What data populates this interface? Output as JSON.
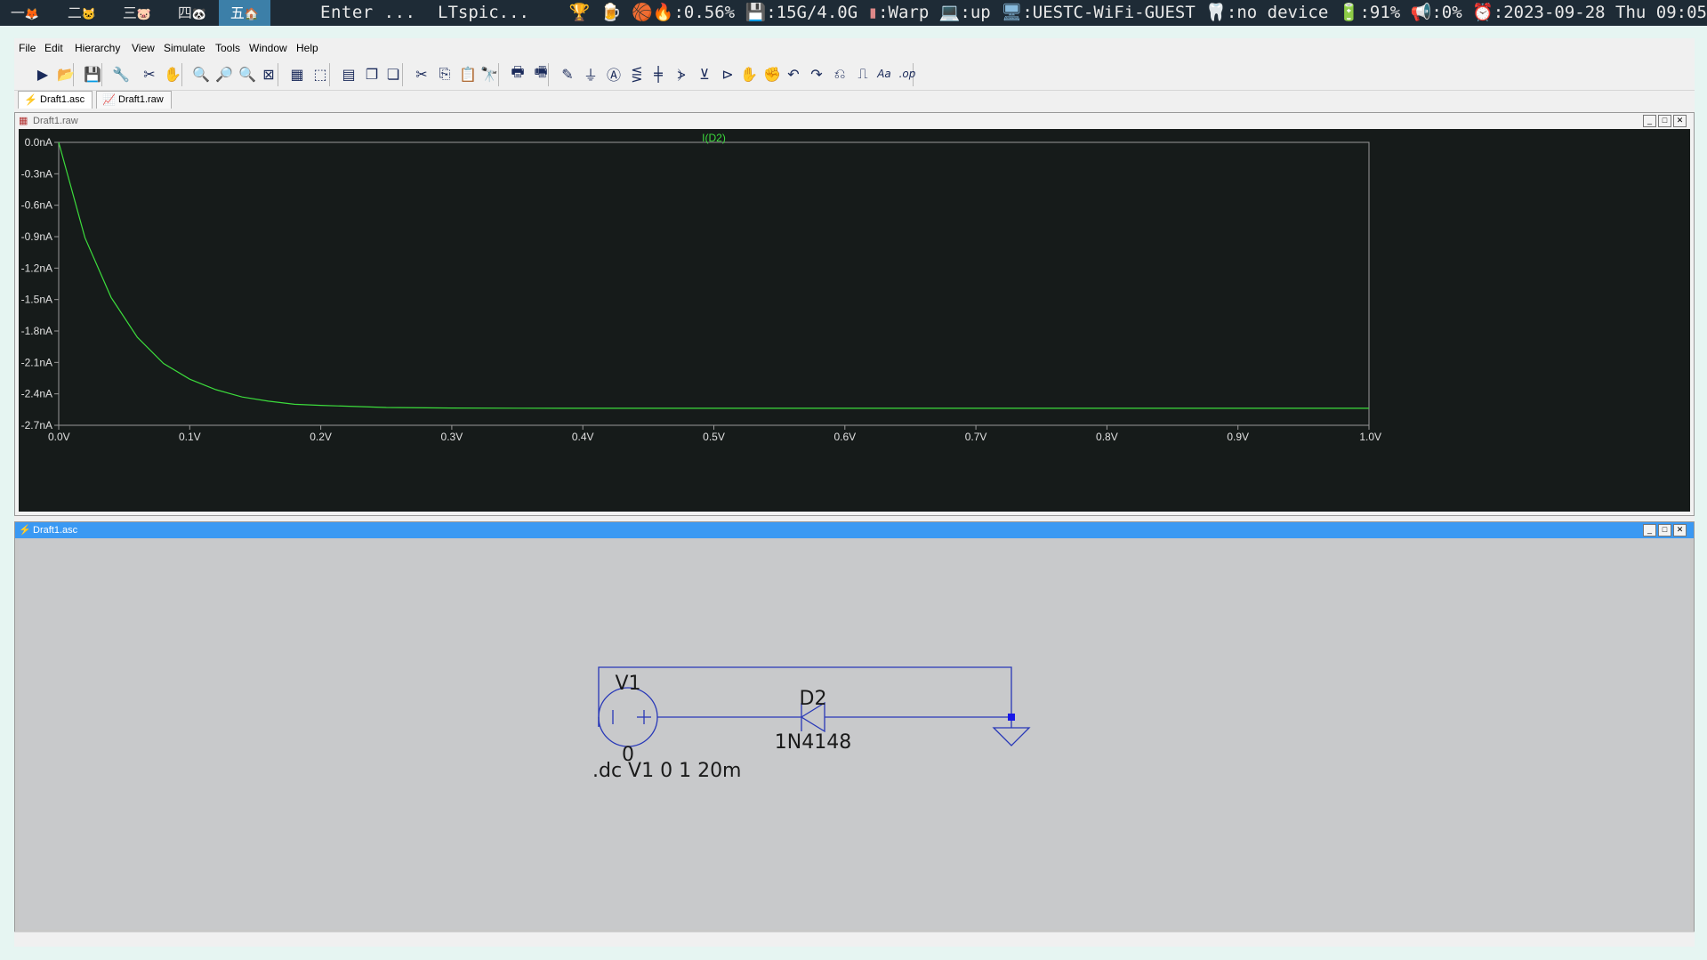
{
  "topbar": {
    "workspaces": [
      {
        "label": "一",
        "icon": "fox-icon",
        "glyph": "🦊"
      },
      {
        "label": "二",
        "icon": "cat-icon",
        "glyph": "🐱"
      },
      {
        "label": "三",
        "icon": "pig-icon",
        "glyph": "🐷"
      },
      {
        "label": "四",
        "icon": "panda-icon",
        "glyph": "🐼"
      },
      {
        "label": "五",
        "icon": "house-icon",
        "glyph": "🏠"
      }
    ],
    "active_workspace": 4,
    "window_title_1": "Enter ...",
    "window_title_2": "LTspic...",
    "status": {
      "cpu": ":0.56%",
      "mem": ":15G/4.0G",
      "terminal": ":Warp",
      "net_state": ":up",
      "wifi": ":UESTC-WiFi-GUEST",
      "bluetooth": ":no device",
      "battery": ":91%",
      "volume": ":0%",
      "datetime": ":2023-09-28 Thu 09:05"
    }
  },
  "menu": [
    "File",
    "Edit",
    "Hierarchy",
    "View",
    "Simulate",
    "Tools",
    "Window",
    "Help"
  ],
  "toolbar": {
    "buttons": [
      {
        "name": "run-icon",
        "glyph": "▶"
      },
      {
        "name": "open-icon",
        "glyph": "📂"
      },
      {
        "name": "save-icon",
        "glyph": "💾"
      },
      {
        "name": "control-panel-icon",
        "glyph": "🔧"
      },
      {
        "name": "halt-icon",
        "glyph": "✂"
      },
      {
        "name": "pan-hand-icon",
        "glyph": "✋"
      },
      {
        "name": "zoom-in-icon",
        "glyph": "🔍"
      },
      {
        "name": "zoom-area-icon",
        "glyph": "🔎"
      },
      {
        "name": "zoom-out-icon",
        "glyph": "🔍"
      },
      {
        "name": "zoom-fit-icon",
        "glyph": "⊠"
      },
      {
        "name": "autorange-icon",
        "glyph": "▦"
      },
      {
        "name": "zoom-extents-icon",
        "glyph": "⬚"
      },
      {
        "name": "tile-horizontal-icon",
        "glyph": "▤"
      },
      {
        "name": "cascade-icon",
        "glyph": "❐"
      },
      {
        "name": "tile-vertical-icon",
        "glyph": "❏"
      },
      {
        "name": "cut-icon",
        "glyph": "✂"
      },
      {
        "name": "copy-icon",
        "glyph": "⎘"
      },
      {
        "name": "paste-icon",
        "glyph": "📋"
      },
      {
        "name": "find-icon",
        "glyph": "🔭"
      },
      {
        "name": "print-icon",
        "glyph": "🖶"
      },
      {
        "name": "print-preview-icon",
        "glyph": "🖷"
      },
      {
        "name": "draw-wire-icon",
        "glyph": "✎"
      },
      {
        "name": "ground-icon",
        "glyph": "⏚"
      },
      {
        "name": "label-net-icon",
        "glyph": "Ⓐ"
      },
      {
        "name": "resistor-icon",
        "glyph": "⋚"
      },
      {
        "name": "capacitor-icon",
        "glyph": "╪"
      },
      {
        "name": "inductor-icon",
        "glyph": "⦔"
      },
      {
        "name": "diode-icon",
        "glyph": "⊻"
      },
      {
        "name": "component-icon",
        "glyph": "⊳"
      },
      {
        "name": "move-icon",
        "glyph": "✋"
      },
      {
        "name": "drag-icon",
        "glyph": "✊"
      },
      {
        "name": "undo-icon",
        "glyph": "↶"
      },
      {
        "name": "redo-icon",
        "glyph": "↷"
      },
      {
        "name": "rotate-icon",
        "glyph": "⎌"
      },
      {
        "name": "mirror-icon",
        "glyph": "⎍"
      },
      {
        "name": "text-icon",
        "glyph": "Aa"
      },
      {
        "name": "spice-directive-icon",
        "glyph": ".op"
      }
    ]
  },
  "tabs": [
    {
      "label": "Draft1.asc",
      "icon": "schematic-icon"
    },
    {
      "label": "Draft1.raw",
      "icon": "waveform-icon"
    }
  ],
  "plot_pane": {
    "title": "Draft1.raw"
  },
  "schematic_pane": {
    "title": "Draft1.asc"
  },
  "schematic": {
    "v1_name": "V1",
    "v1_value": "0",
    "d2_name": "D2",
    "d2_model": "1N4148",
    "directive": ".dc V1 0 1 20m"
  },
  "chart_data": {
    "type": "line",
    "title": "I(D2)",
    "xlabel": "",
    "ylabel": "",
    "x_ticks": [
      "0.0V",
      "0.1V",
      "0.2V",
      "0.3V",
      "0.4V",
      "0.5V",
      "0.6V",
      "0.7V",
      "0.8V",
      "0.9V",
      "1.0V"
    ],
    "y_ticks": [
      "0.0nA",
      "-0.3nA",
      "-0.6nA",
      "-0.9nA",
      "-1.2nA",
      "-1.5nA",
      "-1.8nA",
      "-2.1nA",
      "-2.4nA",
      "-2.7nA"
    ],
    "xlim": [
      0,
      1
    ],
    "ylim": [
      -2.7,
      0
    ],
    "grid": false,
    "trace_color": "#3cdc3c",
    "series": [
      {
        "name": "I(D2)",
        "x": [
          0,
          0.02,
          0.04,
          0.06,
          0.08,
          0.1,
          0.12,
          0.14,
          0.16,
          0.18,
          0.2,
          0.25,
          0.3,
          0.35,
          0.4,
          0.5,
          0.6,
          0.7,
          0.8,
          0.9,
          1.0
        ],
        "values": [
          0,
          -0.91,
          -1.48,
          -1.86,
          -2.11,
          -2.26,
          -2.36,
          -2.43,
          -2.47,
          -2.5,
          -2.51,
          -2.53,
          -2.535,
          -2.537,
          -2.538,
          -2.538,
          -2.538,
          -2.538,
          -2.538,
          -2.538,
          -2.538
        ]
      }
    ]
  }
}
